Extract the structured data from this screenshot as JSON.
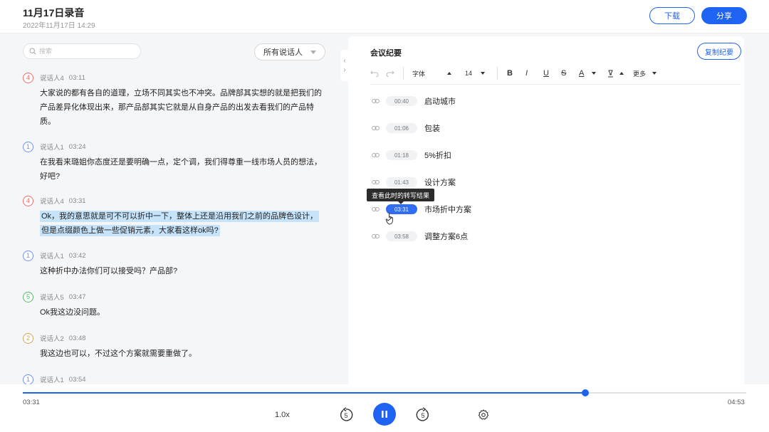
{
  "header": {
    "title": "11月17日录音",
    "subtitle": "2022年11月17日 14:29",
    "download_label": "下载",
    "share_label": "分享"
  },
  "transcript": {
    "search_placeholder": "搜索",
    "speaker_filter": "所有说话人",
    "entries": [
      {
        "num": "4",
        "speaker": "说话人4",
        "time": "03:11",
        "color": "#f26b6b",
        "lines": [
          "大家说的都有各自的道理，立场不同其实也不冲突。品牌部其实想的就是把我们的",
          "产品差异化体现出来，那产品部其实它就是从自身产品的出发去看我们的产品特",
          "质。"
        ]
      },
      {
        "num": "1",
        "speaker": "说话人1",
        "time": "03:24",
        "color": "#6f8ff5",
        "lines": [
          "在我看来璐姐你态度还是要明确一点，定个调，我们得尊重一线市场人员的想法，",
          "好吧?"
        ]
      },
      {
        "num": "4",
        "speaker": "说话人4",
        "time": "03:31",
        "color": "#f26b6b",
        "lines": [
          "Ok，我的意思就是可不可以折中一下，整体上还是沿用我们之前的品牌色设计，",
          "但是点缀颜色上做一些促销元素，大家看这样ok吗?"
        ]
      },
      {
        "num": "1",
        "speaker": "说话人1",
        "time": "03:42",
        "color": "#6f8ff5",
        "lines": [
          "这种折中办法你们可以接受吗？产品部?"
        ]
      },
      {
        "num": "5",
        "speaker": "说话人5",
        "time": "03:47",
        "color": "#52b96a",
        "lines": [
          "Ok我这边没问题。"
        ]
      },
      {
        "num": "2",
        "speaker": "说话人2",
        "time": "03:48",
        "color": "#d6a35c",
        "lines": [
          "我这边也可以，不过这个方案就需要重做了。"
        ]
      },
      {
        "num": "1",
        "speaker": "说话人1",
        "time": "03:54",
        "color": "#6f8ff5",
        "lines": []
      }
    ]
  },
  "notes": {
    "title": "会议纪要",
    "copy_label": "复制纪要",
    "toolbar": {
      "font": "字体",
      "size": "14",
      "bold": "B",
      "italic": "I",
      "underline": "U",
      "strike": "S",
      "color": "A",
      "more": "更多"
    },
    "keypoints": [
      {
        "time": "00:40",
        "text": "启动城市"
      },
      {
        "time": "01:06",
        "text": "包装"
      },
      {
        "time": "01:18",
        "text": "5%折扣"
      },
      {
        "time": "01:43",
        "text": "设计方案"
      },
      {
        "time": "03:31",
        "text": "市场折中方案"
      },
      {
        "time": "03:58",
        "text": "调整方案6点"
      }
    ],
    "tooltip": "查看此时的转写结果"
  },
  "player": {
    "current": "03:31",
    "total": "04:53",
    "speed": "1.0x",
    "skip_seconds": "5",
    "progress": 0.778,
    "accent": "#1f63f2"
  }
}
